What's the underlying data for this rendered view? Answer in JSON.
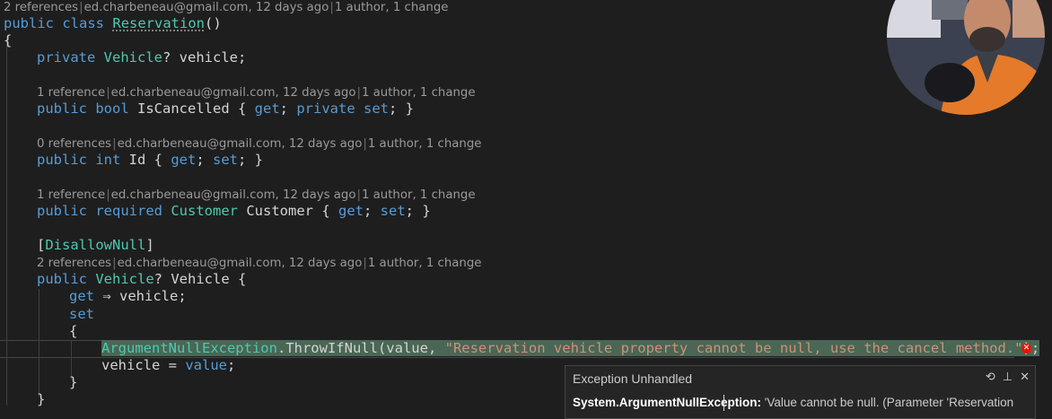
{
  "editor": {
    "lens_class": {
      "refs": "2 references",
      "author": "ed.charbeneau@gmail.com, 12 days ago",
      "changes": "1 author, 1 change"
    },
    "class_decl": {
      "kw1": "public",
      "kw2": "class",
      "name": "Reservation",
      "rest": "()"
    },
    "open_brace": "{",
    "field": {
      "kw": "private",
      "type": "Vehicle",
      "rest": "? vehicle;"
    },
    "lens_iscancelled": {
      "refs": "1 reference",
      "author": "ed.charbeneau@gmail.com, 12 days ago",
      "changes": "1 author, 1 change"
    },
    "prop_iscancelled": {
      "kw1": "public",
      "kw2": "bool",
      "name": " IsCancelled ",
      "ob": "{ ",
      "get": "get",
      "semi1": "; ",
      "priv": "private",
      "set": "set",
      "end": "; }"
    },
    "lens_id": {
      "refs": "0 references",
      "author": "ed.charbeneau@gmail.com, 12 days ago",
      "changes": "1 author, 1 change"
    },
    "prop_id": {
      "kw1": "public",
      "kw2": "int",
      "name": " Id ",
      "ob": "{ ",
      "get": "get",
      "semi1": "; ",
      "set": "set",
      "end": "; }"
    },
    "lens_customer": {
      "refs": "1 reference",
      "author": "ed.charbeneau@gmail.com, 12 days ago",
      "changes": "1 author, 1 change"
    },
    "prop_customer": {
      "kw1": "public",
      "kw2": "required",
      "type": "Customer",
      "name": " Customer ",
      "ob": "{ ",
      "get": "get",
      "semi1": "; ",
      "set": "set",
      "end": "; }"
    },
    "attribute": {
      "open": "[",
      "name": "DisallowNull",
      "close": "]"
    },
    "lens_vehicle": {
      "refs": "2 references",
      "author": "ed.charbeneau@gmail.com, 12 days ago",
      "changes": "1 author, 1 change"
    },
    "prop_vehicle": {
      "kw": "public",
      "type": "Vehicle",
      "rest": "? Vehicle {"
    },
    "getter": {
      "kw": "get",
      "rest": " ⇒ vehicle;"
    },
    "setter": {
      "kw": "set"
    },
    "inner_open": "{",
    "throw_line": {
      "type": "ArgumentNullException",
      "call": ".ThrowIfNull(value, ",
      "str": "\"Reservation vehicle property cannot be null, use the cancel method.\"",
      "end": ");"
    },
    "assign_line": {
      "lhs": "vehicle = ",
      "kw": "value",
      "end": ";"
    },
    "inner_close": "}",
    "outer_close": "}"
  },
  "popup": {
    "title": "Exception Unhandled",
    "exception_type": "System.ArgumentNullException:",
    "message": " 'Value cannot be null. (Parameter 'Reservation"
  },
  "icons": {
    "error": "error-circle-icon",
    "history": "history-icon",
    "pin": "pin-icon",
    "close": "close-icon"
  },
  "colors": {
    "keyword": "#569cd6",
    "type": "#4ec9b0",
    "string": "#ce9178",
    "highlight": "#4a6655",
    "error": "#e51400"
  }
}
